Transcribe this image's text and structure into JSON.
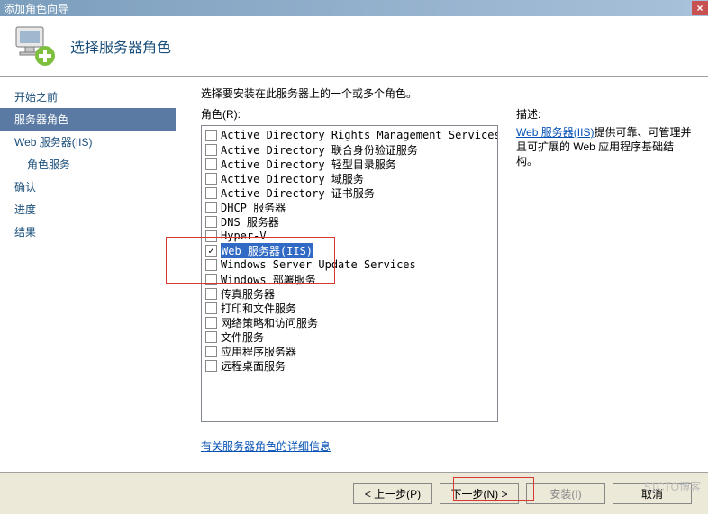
{
  "window": {
    "title": "添加角色向导",
    "close_icon": "×"
  },
  "header": {
    "title": "选择服务器角色"
  },
  "sidebar": {
    "items": [
      {
        "label": "开始之前",
        "selected": false,
        "indent": false
      },
      {
        "label": "服务器角色",
        "selected": true,
        "indent": false
      },
      {
        "label": "Web 服务器(IIS)",
        "selected": false,
        "indent": false
      },
      {
        "label": "角色服务",
        "selected": false,
        "indent": true
      },
      {
        "label": "确认",
        "selected": false,
        "indent": false
      },
      {
        "label": "进度",
        "selected": false,
        "indent": false
      },
      {
        "label": "结果",
        "selected": false,
        "indent": false
      }
    ]
  },
  "main": {
    "instruction": "选择要安装在此服务器上的一个或多个角色。",
    "roles_label": "角色(R):",
    "roles": [
      {
        "label": "Active Directory Rights Management Services",
        "checked": false,
        "selected": false
      },
      {
        "label": "Active Directory 联合身份验证服务",
        "checked": false,
        "selected": false
      },
      {
        "label": "Active Directory 轻型目录服务",
        "checked": false,
        "selected": false
      },
      {
        "label": "Active Directory 域服务",
        "checked": false,
        "selected": false
      },
      {
        "label": "Active Directory 证书服务",
        "checked": false,
        "selected": false
      },
      {
        "label": "DHCP 服务器",
        "checked": false,
        "selected": false
      },
      {
        "label": "DNS 服务器",
        "checked": false,
        "selected": false
      },
      {
        "label": "Hyper-V",
        "checked": false,
        "selected": false
      },
      {
        "label": "Web 服务器(IIS)",
        "checked": true,
        "selected": true
      },
      {
        "label": "Windows Server Update Services",
        "checked": false,
        "selected": false
      },
      {
        "label": "Windows 部署服务",
        "checked": false,
        "selected": false
      },
      {
        "label": "传真服务器",
        "checked": false,
        "selected": false
      },
      {
        "label": "打印和文件服务",
        "checked": false,
        "selected": false
      },
      {
        "label": "网络策略和访问服务",
        "checked": false,
        "selected": false
      },
      {
        "label": "文件服务",
        "checked": false,
        "selected": false
      },
      {
        "label": "应用程序服务器",
        "checked": false,
        "selected": false
      },
      {
        "label": "远程桌面服务",
        "checked": false,
        "selected": false
      }
    ],
    "more_info_link": "有关服务器角色的详细信息",
    "description": {
      "heading": "描述:",
      "link_text": "Web 服务器(IIS)",
      "body_text": "提供可靠、可管理并且可扩展的 Web 应用程序基础结构。"
    }
  },
  "footer": {
    "prev": "< 上一步(P)",
    "next": "下一步(N) >",
    "install": "安装(I)",
    "cancel": "取消"
  },
  "watermark": "51CTO博客"
}
